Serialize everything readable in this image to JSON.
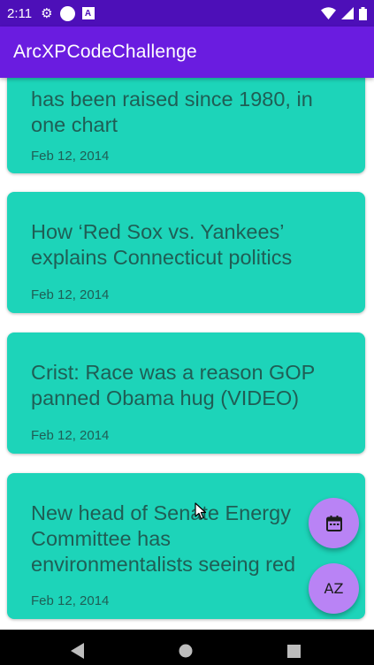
{
  "status_bar": {
    "time": "2:11",
    "app_icon_label": "A",
    "icons": [
      "gear-icon",
      "notification-badge-icon",
      "app-a-icon",
      "wifi-icon",
      "signal-icon",
      "battery-icon"
    ]
  },
  "app_bar": {
    "title": "ArcXPCodeChallenge"
  },
  "articles": [
    {
      "title": "has been raised since 1980, in one chart",
      "date": "Feb 12, 2014"
    },
    {
      "title": "How ‘Red Sox vs. Yankees’ explains Connecticut politics",
      "date": "Feb 12, 2014"
    },
    {
      "title": "Crist: Race was a reason GOP panned Obama hug (VIDEO)",
      "date": "Feb 12, 2014"
    },
    {
      "title": "New head of Senate Energy Committee has environmentalists seeing red",
      "date": "Feb 12, 2014"
    }
  ],
  "fabs": {
    "date_sort_icon": "calendar-icon",
    "alpha_sort_label": "AZ"
  },
  "nav_bar": {
    "icons": [
      "back-icon",
      "home-icon",
      "recents-icon"
    ]
  },
  "colors": {
    "status_bar": "#4d0fb8",
    "app_bar": "#6a1ce0",
    "card": "#1dd4b9",
    "card_text": "#1f5e55",
    "fab": "#b983f5"
  }
}
